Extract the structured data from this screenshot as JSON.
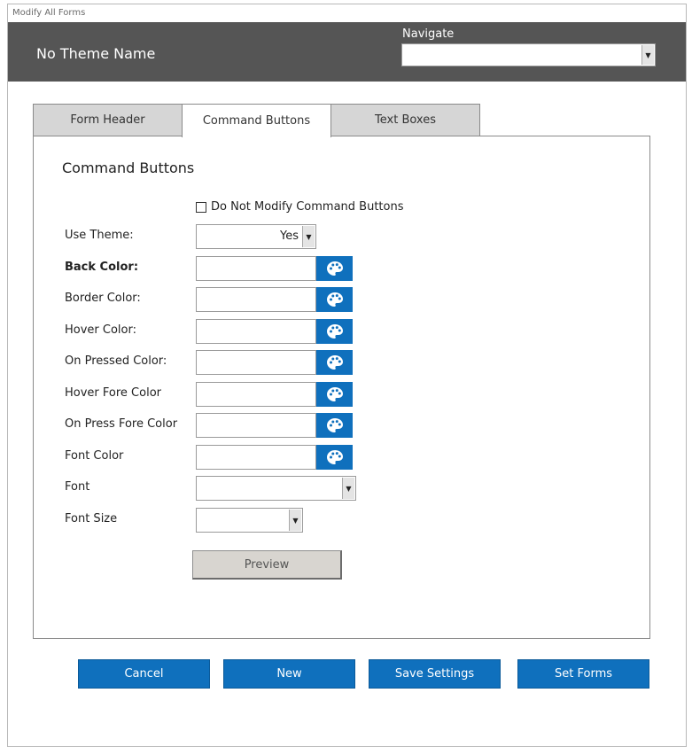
{
  "window": {
    "title": "Modify All Forms"
  },
  "header": {
    "theme_name": "No Theme Name",
    "navigate_label": "Navigate",
    "navigate_value": ""
  },
  "tabs": [
    {
      "label": "Form Header",
      "active": false
    },
    {
      "label": "Command Buttons",
      "active": true
    },
    {
      "label": "Text Boxes",
      "active": false
    }
  ],
  "panel": {
    "title": "Command Buttons",
    "checkbox": {
      "label": "Do Not Modify Command Buttons",
      "checked": false
    },
    "use_theme": {
      "label": "Use Theme:",
      "value": "Yes"
    },
    "color_fields": [
      {
        "label": "Back Color:",
        "value": ""
      },
      {
        "label": "Border Color:",
        "value": ""
      },
      {
        "label": "Hover Color:",
        "value": ""
      },
      {
        "label": "On Pressed Color:",
        "value": ""
      },
      {
        "label": "Hover Fore Color",
        "value": ""
      },
      {
        "label": "On Press Fore Color",
        "value": ""
      },
      {
        "label": "Font Color",
        "value": ""
      }
    ],
    "font": {
      "label": "Font",
      "value": ""
    },
    "font_size": {
      "label": "Font Size",
      "value": ""
    },
    "preview_label": "Preview"
  },
  "actions": {
    "cancel": "Cancel",
    "new": "New",
    "save": "Save Settings",
    "set_forms": "Set Forms"
  },
  "colors": {
    "header_bg": "#555555",
    "accent_blue": "#0f70bd",
    "preview_bg": "#d8d5d0"
  },
  "icons": {
    "palette": "palette-icon",
    "dropdown": "chevron-down-icon"
  }
}
